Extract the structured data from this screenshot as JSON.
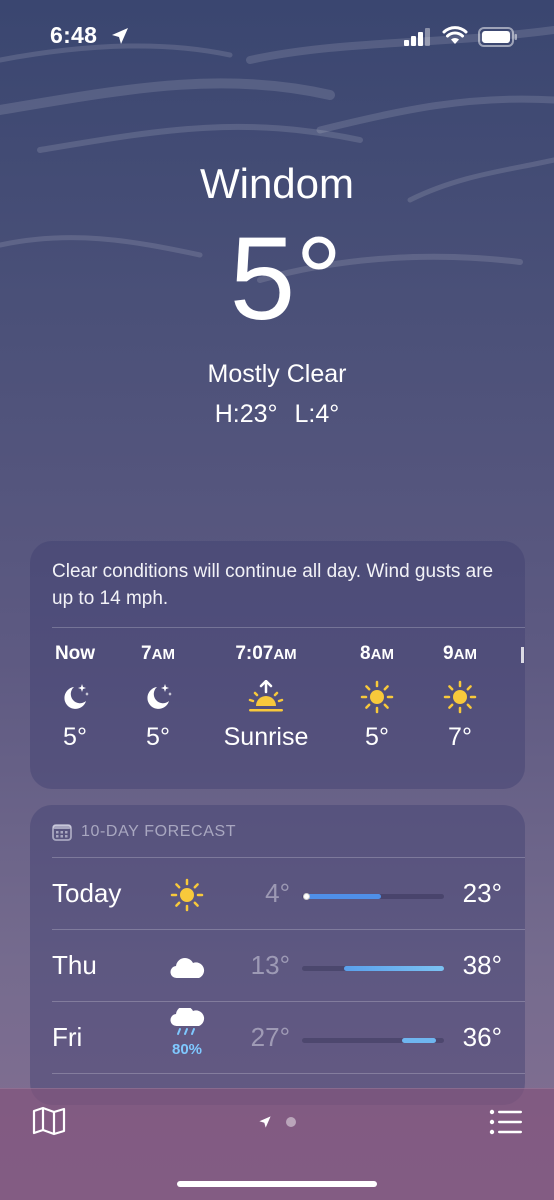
{
  "status_bar": {
    "time": "6:48"
  },
  "header": {
    "city": "Windom",
    "temperature": "5°",
    "condition": "Mostly Clear",
    "high": "H:23°",
    "low": "L:4°"
  },
  "hourly": {
    "summary": "Clear conditions will continue all day. Wind gusts are up to 14 mph.",
    "items": [
      {
        "label": "Now",
        "suffix": "",
        "icon": "moon-stars-icon",
        "value": "5°"
      },
      {
        "label": "7",
        "suffix": "AM",
        "icon": "moon-stars-icon",
        "value": "5°"
      },
      {
        "label": "7:07",
        "suffix": "AM",
        "icon": "sunrise-icon",
        "value": "Sunrise"
      },
      {
        "label": "8",
        "suffix": "AM",
        "icon": "sun-icon",
        "value": "5°"
      },
      {
        "label": "9",
        "suffix": "AM",
        "icon": "sun-icon",
        "value": "7°"
      }
    ]
  },
  "forecast": {
    "header": "10-DAY FORECAST",
    "range_min": 4,
    "range_max": 38,
    "days": [
      {
        "day": "Today",
        "icon": "sun-icon",
        "precip": "",
        "low": "4°",
        "high": "23°",
        "low_value": 4,
        "high_value": 23,
        "current_value": 5
      },
      {
        "day": "Thu",
        "icon": "cloud-icon",
        "precip": "",
        "low": "13°",
        "high": "38°",
        "low_value": 13,
        "high_value": 38
      },
      {
        "day": "Fri",
        "icon": "cloud-rain-icon",
        "precip": "80%",
        "low": "27°",
        "high": "36°",
        "low_value": 27,
        "high_value": 36
      }
    ]
  },
  "colors": {
    "sun": "#f8c93b",
    "bar_cool": "#4f8fe8",
    "bar_mid": "#6fb6f0",
    "precip": "#7fc8ff"
  }
}
